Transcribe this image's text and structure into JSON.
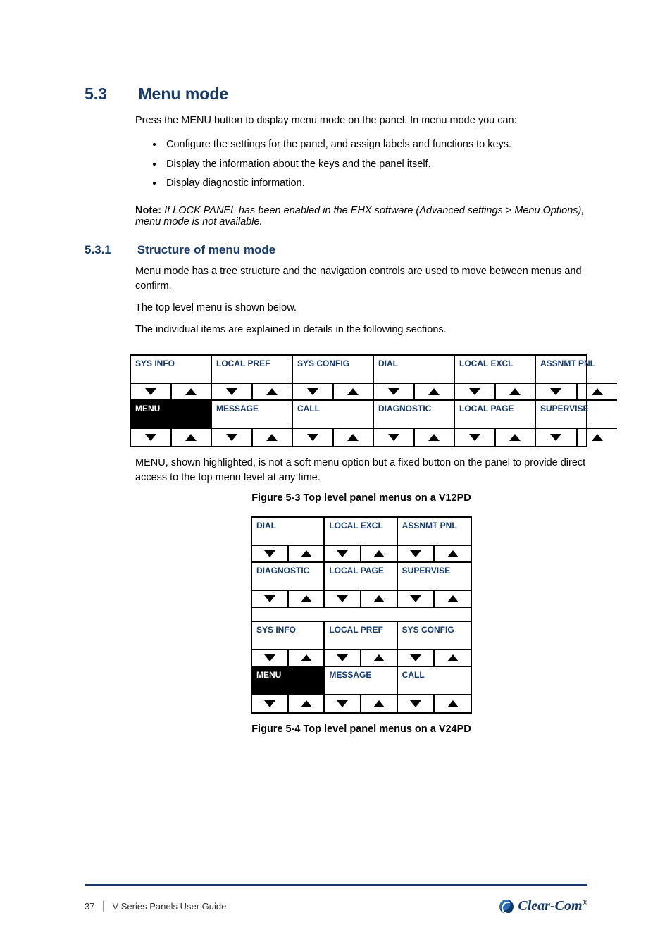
{
  "section": {
    "num": "5.3",
    "title": "Menu mode",
    "intro": "Press the MENU button to display menu mode on the panel. In menu mode you can:",
    "bullets": [
      "Configure the settings for the panel, and assign labels and functions to keys.",
      "Display the information about the keys and the panel itself.",
      "Display diagnostic information."
    ],
    "sub_num": "5.3.1",
    "sub_title": "Structure of menu mode",
    "sub_body": [
      "Menu mode has a tree structure and the navigation controls are used to move between menus and confirm.",
      "The top level menu is shown below.",
      "The individual items are explained in details in the following sections."
    ],
    "post_body": "MENU, shown highlighted, is not a soft menu option but a fixed button on the panel to provide direct access to the top menu level at any time.",
    "note_label": "Note:",
    "note_body": "If LOCK PANEL has been enabled in the EHX software (Advanced settings > Menu Options), menu mode is not available.",
    "fig_top": "Figure 5-3 Top level panel menus on a V12PD",
    "fig_bot": "Figure 5-4 Top level panel menus on a V24PD"
  },
  "grid_wide": {
    "row1": [
      "SYS INFO",
      "LOCAL PREF",
      "SYS CONFIG",
      "DIAL",
      "LOCAL EXCL",
      "ASSNMT PNL"
    ],
    "row2": [
      "MENU",
      "MESSAGE",
      "CALL",
      "DIAGNOSTIC",
      "LOCAL PAGE",
      "SUPERVISE"
    ]
  },
  "grid_square": {
    "row1": [
      "DIAL",
      "LOCAL EXCL",
      "ASSNMT PNL"
    ],
    "row2": [
      "DIAGNOSTIC",
      "LOCAL PAGE",
      "SUPERVISE"
    ],
    "row3": [
      "SYS INFO",
      "LOCAL PREF",
      "SYS CONFIG"
    ],
    "row4": [
      "MENU",
      "MESSAGE",
      "CALL"
    ]
  },
  "footer": {
    "page": "37",
    "doc": "V-Series Panels User Guide",
    "brand": "Clear-Com"
  }
}
